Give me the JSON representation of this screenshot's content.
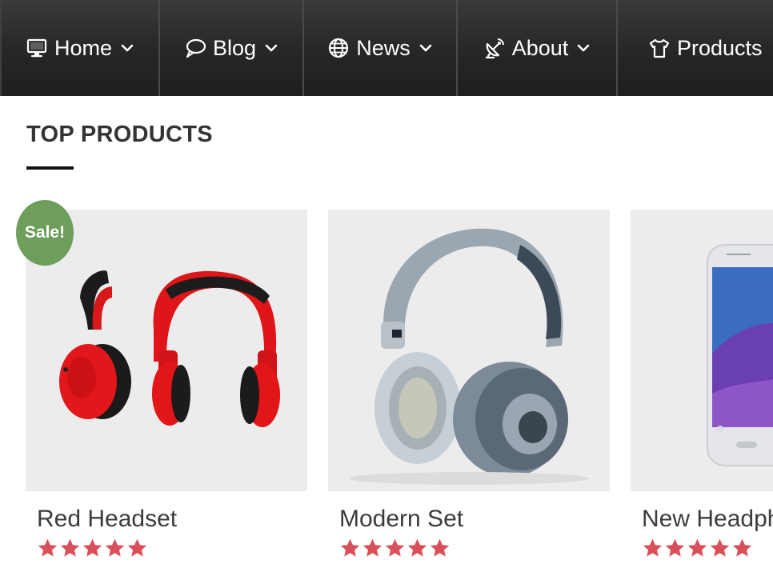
{
  "nav": {
    "items": [
      {
        "label": "Home",
        "icon": "monitor-icon",
        "has_dropdown": true
      },
      {
        "label": "Blog",
        "icon": "speech-bubble-icon",
        "has_dropdown": true
      },
      {
        "label": "News",
        "icon": "globe-icon",
        "has_dropdown": true
      },
      {
        "label": "About",
        "icon": "satellite-dish-icon",
        "has_dropdown": true
      },
      {
        "label": "Products",
        "icon": "tshirt-icon",
        "has_dropdown": false
      }
    ]
  },
  "section": {
    "title": "TOP PRODUCTS"
  },
  "products": [
    {
      "name": "Red Headset",
      "rating": 5,
      "sale_label": "Sale!",
      "image": "red-headphones-pair"
    },
    {
      "name": "Modern Set",
      "rating": 5,
      "image": "silver-headphones"
    },
    {
      "name": "New Headph",
      "rating": 5,
      "image": "samsung-phone"
    }
  ],
  "colors": {
    "nav_bg": "#262626",
    "star": "#d9505a",
    "sale_badge": "#6d9e5c",
    "card_bg": "#ececec"
  }
}
